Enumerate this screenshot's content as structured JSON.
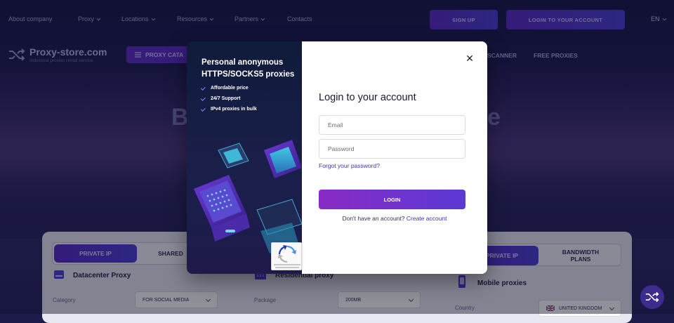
{
  "nav": {
    "links": [
      {
        "label": "About company",
        "caret": false
      },
      {
        "label": "Proxy",
        "caret": true
      },
      {
        "label": "Locations",
        "caret": true
      },
      {
        "label": "Resources",
        "caret": true
      },
      {
        "label": "Partners",
        "caret": true
      },
      {
        "label": "Contacts",
        "caret": false
      }
    ],
    "sign_up": "SIGN UP",
    "login": "LOGIN TO YOUR ACCOUNT",
    "language": "EN"
  },
  "brand": {
    "name": "Proxy-store.com",
    "tagline": "Individual proxies rental service"
  },
  "subnav": {
    "catalog": "PROXY CATA",
    "scanner": "SCANNER",
    "free": "FREE PROXIES"
  },
  "hero": {
    "left": "B",
    "right": "e"
  },
  "cards": [
    {
      "tab_on": "PRIVATE IP",
      "tab_off": "SHARED",
      "title": "Datacenter Proxy",
      "field_label": "Category",
      "field_value": "FOR SOCIAL MEDIA"
    },
    {
      "title": "Residential proxy",
      "field_label": "Package",
      "field_value": "200MB"
    },
    {
      "tab_on": "PRIVATE IP",
      "tab_off": "BANDWIDTH PLANS",
      "title": "Mobile proxies",
      "field_label": "Country",
      "field_value": "UNITED KINGDOM"
    }
  ],
  "modal": {
    "promo_title": "Personal anonymous HTTPS/SOCKS5 proxies",
    "features": [
      "Affordable price",
      "24/7 Support",
      "IPv4 proxies in bulk"
    ],
    "heading": "Login to your account",
    "email_placeholder": "Email",
    "password_placeholder": "Password",
    "forgot": "Forgot your password?",
    "login_button": "LOGIN",
    "no_account": "Don't have an account?",
    "create_account": "Create account"
  },
  "colors": {
    "accent": "#5a2bc4",
    "link": "#3d33b3",
    "bg": "#1c1b4c"
  }
}
